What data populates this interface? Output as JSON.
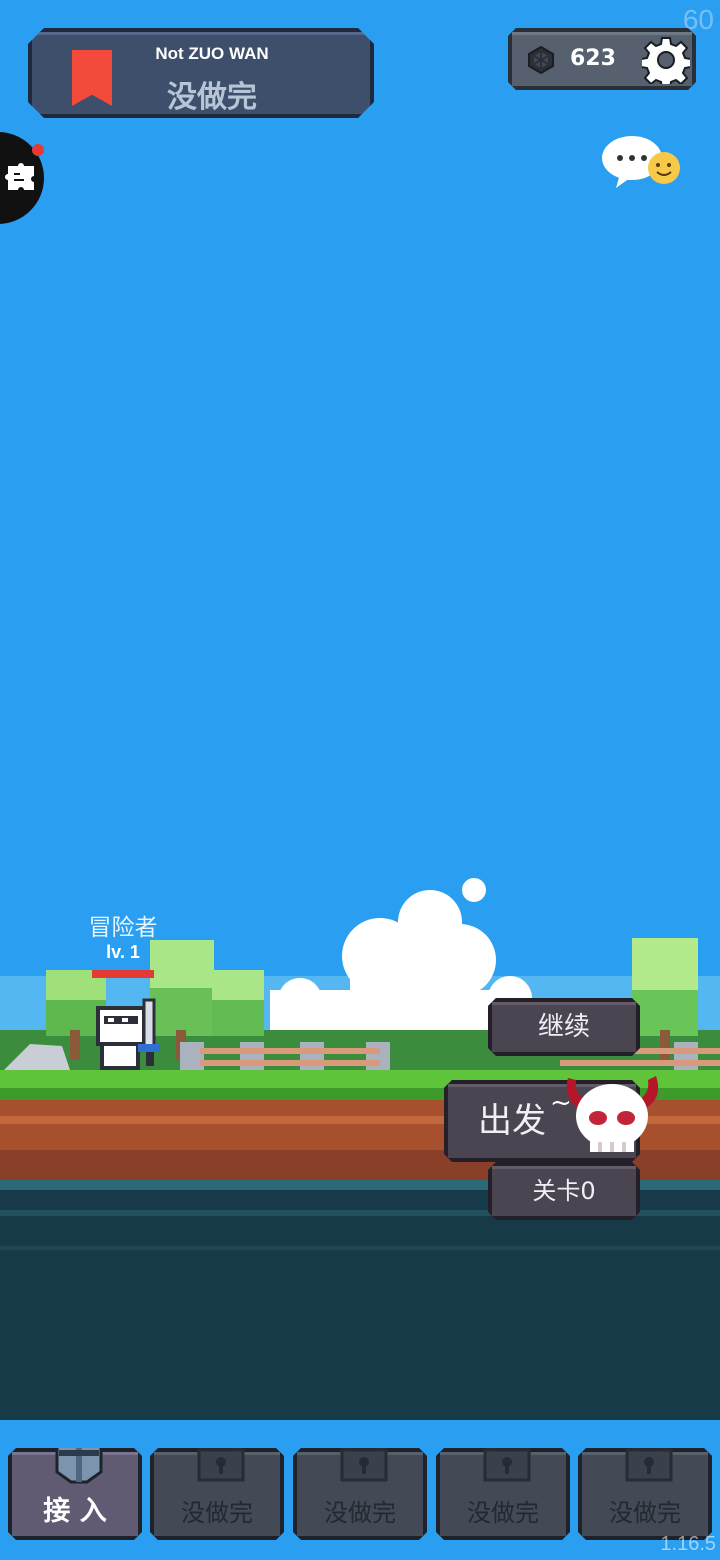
{
  "hud": {
    "fps": "60",
    "version": "1.16.5",
    "title_en": "Not ZUO WAN",
    "title_cn": "没做完",
    "gem_count": "623"
  },
  "player": {
    "name": "冒险者",
    "level": "lv. 1"
  },
  "actions": {
    "continue_label": "继续",
    "go_label": "出发",
    "go_tilde": "~",
    "stage_label": "关卡0"
  },
  "nav": {
    "items": [
      {
        "label": "接 入",
        "icon": "helmet-icon",
        "active": true
      },
      {
        "label": "没做完",
        "icon": "lock-icon",
        "active": false
      },
      {
        "label": "没做完",
        "icon": "lock-icon",
        "active": false
      },
      {
        "label": "没做完",
        "icon": "lock-icon",
        "active": false
      },
      {
        "label": "没做完",
        "icon": "lock-icon",
        "active": false
      }
    ]
  },
  "colors": {
    "sky": "#2a9ff2",
    "bookmark": "#f44a3c",
    "hp": "#e53935",
    "button": "#4a4550"
  }
}
